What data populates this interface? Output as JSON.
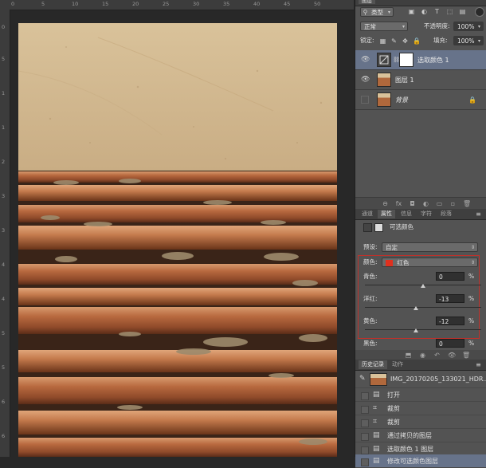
{
  "rulers": {
    "top_labels": [
      "0",
      "5",
      "10",
      "15",
      "20",
      "25",
      "30",
      "35",
      "40",
      "45",
      "50"
    ],
    "left_labels": [
      "0",
      "5",
      "1",
      "1",
      "2",
      "3",
      "3",
      "4",
      "4",
      "5",
      "5",
      "6",
      "6"
    ]
  },
  "layers_panel": {
    "title": "图层",
    "filter_kind": "类型",
    "blend_mode": "正常",
    "opacity_label": "不透明度:",
    "opacity_value": "100%",
    "lock_label": "锁定:",
    "fill_label": "填充:",
    "fill_value": "100%",
    "layers": [
      {
        "name": "选取颜色 1",
        "visible": true,
        "selected": true
      },
      {
        "name": "图层 1",
        "visible": true,
        "selected": false
      },
      {
        "name": "背景",
        "visible": false,
        "selected": false,
        "locked": true
      }
    ]
  },
  "properties_panel": {
    "tabs": [
      "通道",
      "属性",
      "信息",
      "字符",
      "段落"
    ],
    "active_tab": "属性",
    "title": "可选颜色",
    "preset_label": "预设:",
    "preset_value": "自定",
    "colors_label": "颜色:",
    "colors_value": "红色",
    "swatch_color": "#e0301e",
    "highlight_color": "#c0302a",
    "sliders": [
      {
        "label": "青色:",
        "value": "0",
        "unit": "%",
        "level": 0
      },
      {
        "label": "洋红:",
        "value": "-13",
        "unit": "%",
        "level": -13
      },
      {
        "label": "黄色:",
        "value": "-12",
        "unit": "%",
        "level": -12
      },
      {
        "label": "黑色:",
        "value": "0",
        "unit": "%",
        "level": 0
      }
    ]
  },
  "history_panel": {
    "tabs": [
      "历史记录",
      "动作"
    ],
    "active_tab": "历史记录",
    "snapshot_name": "IMG_20170205_133021_HDR....",
    "items": [
      "打开",
      "裁剪",
      "裁剪",
      "通过拷贝的图层",
      "选取颜色 1 图层",
      "修改可选颜色图层"
    ]
  }
}
